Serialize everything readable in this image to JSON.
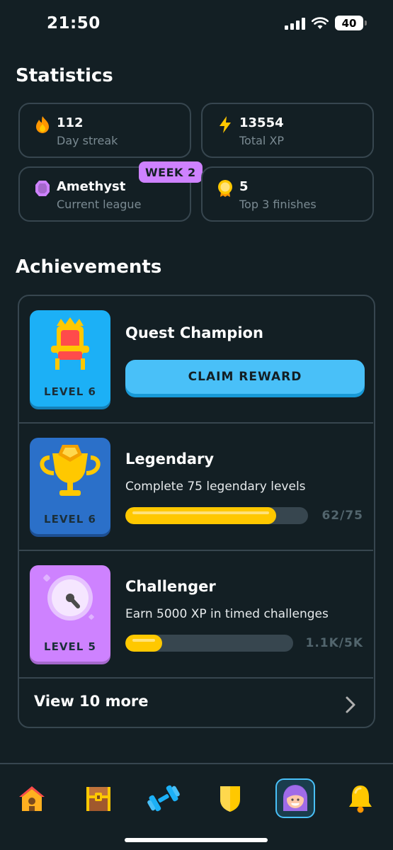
{
  "status_bar": {
    "time": "21:50",
    "battery": "40"
  },
  "statistics": {
    "title": "Statistics",
    "cards": [
      {
        "value": "112",
        "label": "Day streak",
        "icon": "flame-icon"
      },
      {
        "value": "13554",
        "label": "Total XP",
        "icon": "lightning-icon"
      },
      {
        "value": "Amethyst",
        "label": "Current league",
        "icon": "amethyst-gem-icon",
        "badge": "WEEK 2"
      },
      {
        "value": "5",
        "label": "Top 3 finishes",
        "icon": "medal-icon"
      }
    ]
  },
  "achievements": {
    "title": "Achievements",
    "items": [
      {
        "title": "Quest Champion",
        "level": "LEVEL 6",
        "button": "CLAIM REWARD",
        "badge_color": "#1cb0f6",
        "icon": "throne-icon"
      },
      {
        "title": "Legendary",
        "level": "LEVEL 6",
        "description": "Complete 75 legendary levels",
        "progress_text": "62/75",
        "progress": 0.827,
        "badge_color": "#2b70c9",
        "icon": "trophy-icon"
      },
      {
        "title": "Challenger",
        "level": "LEVEL 5",
        "description": "Earn 5000 XP in timed challenges",
        "progress_text": "1.1K/5K",
        "progress": 0.22,
        "badge_color": "#ce82ff",
        "icon": "stopwatch-icon"
      }
    ],
    "view_more": "View 10 more"
  },
  "nav": [
    {
      "name": "home",
      "icon": "home-icon"
    },
    {
      "name": "chest",
      "icon": "treasure-chest-icon"
    },
    {
      "name": "practice",
      "icon": "dumbbell-icon"
    },
    {
      "name": "leagues",
      "icon": "shield-icon"
    },
    {
      "name": "profile",
      "icon": "profile-avatar-icon",
      "active": true
    },
    {
      "name": "notifications",
      "icon": "bell-icon"
    }
  ],
  "colors": {
    "background": "#131f24",
    "border": "#37464f",
    "accent_blue": "#49c0f8",
    "progress_yellow": "#ffc800",
    "league_purple": "#ce82ff"
  }
}
